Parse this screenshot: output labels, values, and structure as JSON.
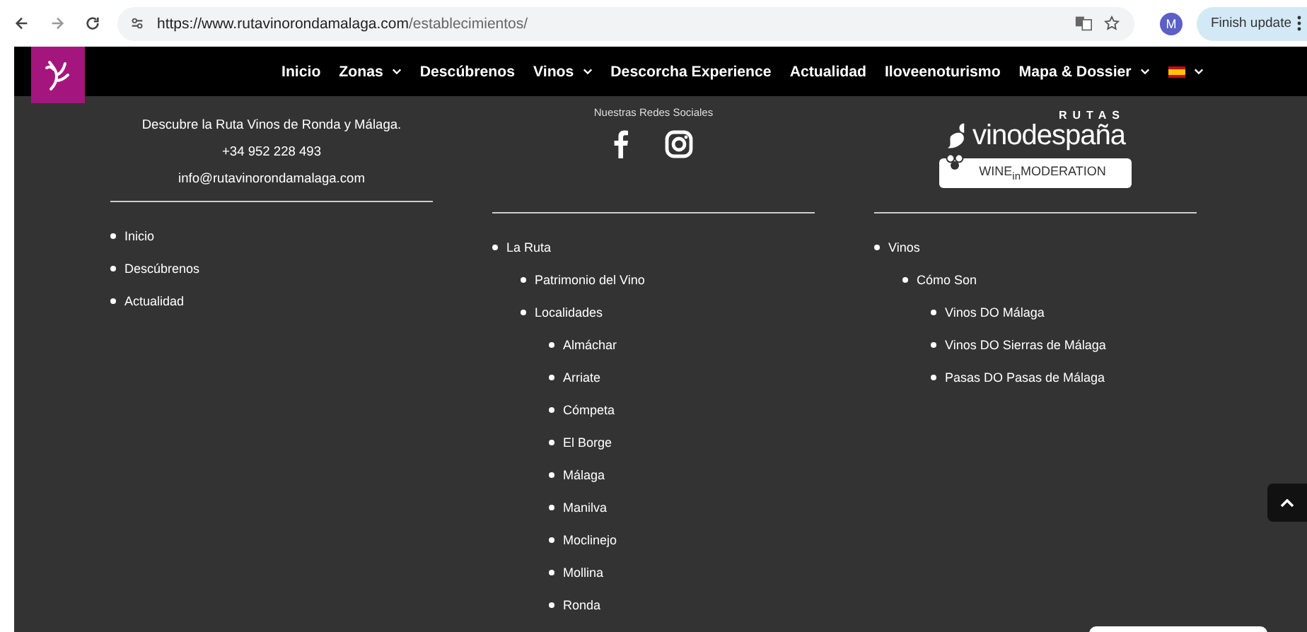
{
  "browser": {
    "url_host": "https://www.rutavinorondamalaga.com",
    "url_path": "/establecimientos/",
    "avatar": "M",
    "update_button": "Finish update"
  },
  "nav": {
    "items": [
      {
        "label": "Inicio",
        "dropdown": false
      },
      {
        "label": "Zonas",
        "dropdown": true
      },
      {
        "label": "Descúbrenos",
        "dropdown": false
      },
      {
        "label": "Vinos",
        "dropdown": true
      },
      {
        "label": "Descorcha Experience",
        "dropdown": false
      },
      {
        "label": "Actualidad",
        "dropdown": false
      },
      {
        "label": "Iloveenoturismo",
        "dropdown": false
      },
      {
        "label": "Mapa & Dossier",
        "dropdown": true
      }
    ]
  },
  "footer": {
    "contact": [
      "Descubre la Ruta Vinos de Ronda y Málaga.",
      "+34 952 228 493",
      "info@rutavinorondamalaga.com"
    ],
    "social_heading": "Nuestras Redes Sociales",
    "logo_rutas": "RUTAS",
    "logo_vino": "vinodespaña",
    "wine_moderation": "WINE$_{in}$MODERATION",
    "columns": [
      {
        "items": [
          {
            "label": "Inicio"
          },
          {
            "label": "Descúbrenos"
          },
          {
            "label": "Actualidad"
          }
        ]
      },
      {
        "items": [
          {
            "label": "La Ruta",
            "children": [
              {
                "label": "Patrimonio del Vino"
              },
              {
                "label": "Localidades",
                "children": [
                  {
                    "label": "Almáchar"
                  },
                  {
                    "label": "Arriate"
                  },
                  {
                    "label": "Cómpeta"
                  },
                  {
                    "label": "El Borge"
                  },
                  {
                    "label": "Málaga"
                  },
                  {
                    "label": "Manilva"
                  },
                  {
                    "label": "Moclinejo"
                  },
                  {
                    "label": "Mollina"
                  },
                  {
                    "label": "Ronda"
                  }
                ]
              }
            ]
          }
        ]
      },
      {
        "items": [
          {
            "label": "Vinos",
            "children": [
              {
                "label": "Cómo Son",
                "children": [
                  {
                    "label": "Vinos DO Málaga"
                  },
                  {
                    "label": "Vinos DO Sierras de Málaga"
                  },
                  {
                    "label": "Pasas DO Pasas de Málaga"
                  }
                ]
              }
            ]
          }
        ]
      }
    ]
  }
}
